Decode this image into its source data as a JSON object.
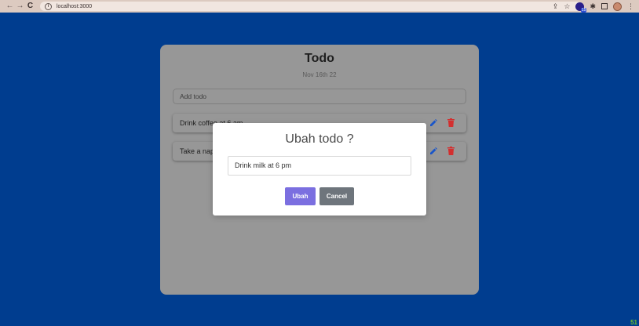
{
  "browser": {
    "url": "localhost:3000",
    "extension_badge": "15"
  },
  "app": {
    "title": "Todo",
    "date": "Nov 16th 22",
    "add_placeholder": "Add todo",
    "todos": [
      {
        "text": "Drink coffee at 6 am"
      },
      {
        "text": "Take a nap"
      }
    ]
  },
  "modal": {
    "title": "Ubah todo ?",
    "input_value": "Drink milk at 6 pm",
    "confirm_label": "Ubah",
    "cancel_label": "Cancel"
  },
  "colors": {
    "background": "#003d8f",
    "edit_icon": "#1a56c9",
    "delete_icon": "#d32f2f",
    "ubah_button": "#7b6fe0",
    "cancel_button": "#6e757c"
  },
  "corner_text": "51"
}
